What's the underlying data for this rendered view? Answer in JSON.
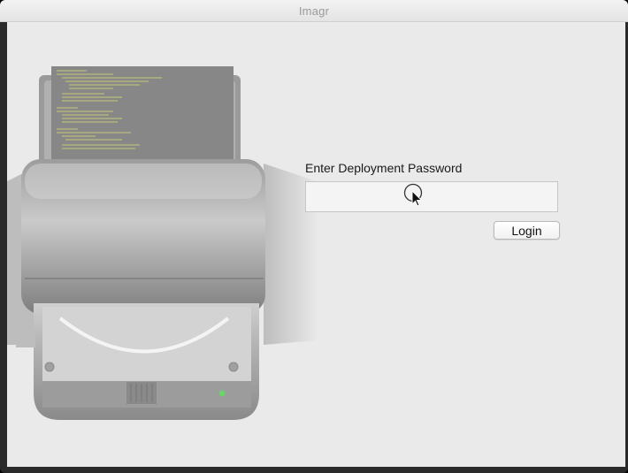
{
  "window": {
    "title": "Imagr"
  },
  "login": {
    "prompt_label": "Enter Deployment Password",
    "password_value": "",
    "button_label": "Login"
  },
  "icons": {
    "hero": "printer-disk-icon",
    "cursor": "mouse-pointer-icon"
  },
  "colors": {
    "content_bg": "#eaeaea",
    "titlebar_text": "#9a9a9a"
  }
}
